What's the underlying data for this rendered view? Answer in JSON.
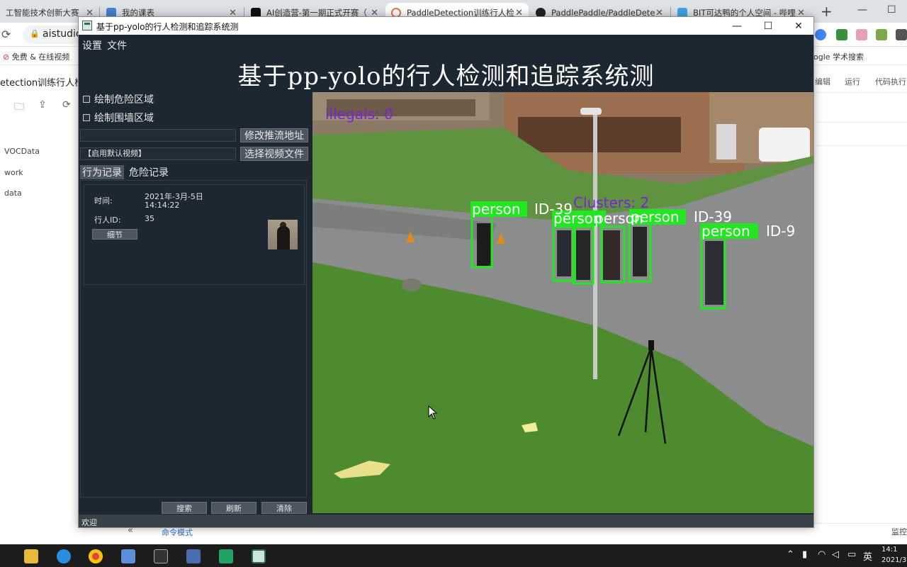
{
  "browser": {
    "tabs": [
      {
        "label": "工智能技术创新大赛",
        "fav": "#3b6fd6"
      },
      {
        "label": "我的课表",
        "fav": "#4a7fd1"
      },
      {
        "label": "AI创造营-第一期正式开赛（",
        "fav": "#111111"
      },
      {
        "label": "PaddleDetection训练行人检",
        "fav": "#e8743b"
      },
      {
        "label": "PaddlePaddle/PaddleDete",
        "fav": "#222222"
      },
      {
        "label": "BIT可达鸭的个人空间 - 哔哩",
        "fav": "#3da5e8"
      }
    ],
    "new_tab": "+",
    "url": "aistudio",
    "bookmarks": [
      "免费 & 在线视频",
      "ogle 学术搜索"
    ],
    "page": {
      "title": "etection训练行人检",
      "files": [
        "VOCData",
        "work",
        "data"
      ],
      "right_menu": [
        "编辑",
        "运行",
        "代码执行"
      ],
      "command_mode": "命令模式",
      "monitor": "监控"
    }
  },
  "window": {
    "title": "基于pp-yolo的行人检测和追踪系统测",
    "controls": {
      "minimize": "—",
      "maximize": "☐",
      "close": "✕"
    }
  },
  "menu": [
    "设置",
    "文件"
  ],
  "app_title": "基于pp-yolo的行人检测和追踪系统测",
  "sidebar": {
    "checkbox_danger": "绘制危险区域",
    "checkbox_fence": "绘制围墙区域",
    "stream_input": "",
    "stream_button": "修改推流地址",
    "video_input": "【启用默认视频】",
    "video_button": "选择视频文件",
    "tabs": [
      "行为记录",
      "危险记录"
    ],
    "record": {
      "time_label": "时间:",
      "date": "2021年-3月-5日",
      "time": "14:14:22",
      "id_label": "行人ID:",
      "id_value": "35",
      "detail_button": "细节"
    },
    "buttons": [
      "搜索",
      "刷新",
      "清除"
    ]
  },
  "status": "欢迎",
  "video": {
    "overlay_illegals": "illegals: 0",
    "overlay_clusters": "Clusters: 2",
    "detections": [
      {
        "label": "person",
        "id": "ID-39"
      },
      {
        "label": "person",
        "id": ""
      },
      {
        "label": "person",
        "id": ""
      },
      {
        "label": "person",
        "id": "ID-39"
      },
      {
        "label": "person",
        "id": "ID-9"
      }
    ],
    "colors": {
      "box": "#22e622",
      "overlay": "#7a22d6"
    }
  },
  "taskbar": {
    "ime": "英",
    "time": "14:1",
    "date": "2021/3"
  }
}
